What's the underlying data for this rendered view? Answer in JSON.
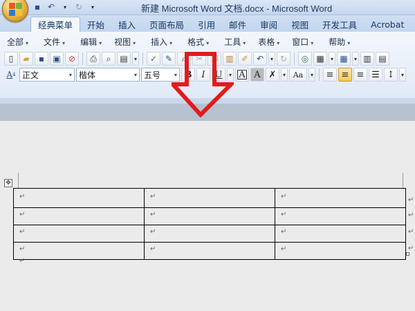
{
  "window": {
    "title": "新建 Microsoft Word 文档.docx - Microsoft Word"
  },
  "ribbon_tabs": [
    {
      "label": "经典菜单",
      "active": true
    },
    {
      "label": "开始",
      "active": false
    },
    {
      "label": "插入",
      "active": false
    },
    {
      "label": "页面布局",
      "active": false
    },
    {
      "label": "引用",
      "active": false
    },
    {
      "label": "邮件",
      "active": false
    },
    {
      "label": "审阅",
      "active": false
    },
    {
      "label": "视图",
      "active": false
    },
    {
      "label": "开发工具",
      "active": false
    },
    {
      "label": "Acrobat",
      "active": false
    }
  ],
  "menus": [
    "全部",
    "文件",
    "编辑",
    "视图",
    "插入",
    "格式",
    "工具",
    "表格",
    "窗口",
    "帮助"
  ],
  "format_bar": {
    "style": "正文",
    "font": "楷体",
    "size": "五号",
    "bold": "B",
    "italic": "I",
    "underline": "U",
    "char_border": "A",
    "char_shading": "A",
    "change_case": "Aa",
    "style_icon": "A",
    "style_icon_number": "4"
  },
  "document": {
    "paragraph_mark": "↵",
    "table_rows": 4,
    "table_cols": 3
  },
  "colors": {
    "accent_red": "#e21b1b",
    "ribbon_bg": "#dfe9f6",
    "tab_text": "#15355f"
  }
}
